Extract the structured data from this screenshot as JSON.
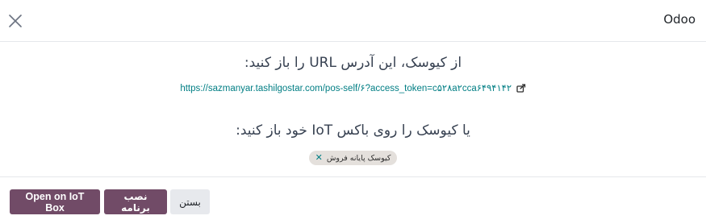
{
  "header": {
    "title": "Odoo"
  },
  "body": {
    "kiosk_url_heading": "از کیوسک، این آدرس URL را باز کنید:",
    "kiosk_url": "https://sazmanyar.tashilgostar.com/pos-self/۶?access_token=c۵۲۸a۲cca۶۴۹۴۱۴۲",
    "iot_heading": "یا کیوسک را روی باکس IoT خود باز کنید:",
    "iot_tag": "کیوسک پایانه فروش"
  },
  "footer": {
    "open_iot_label": "Open on IoT Box",
    "install_app_label": "نصب برنامه",
    "close_label": "بستن"
  },
  "colors": {
    "primary": "#714b67",
    "link": "#017e84",
    "tag_bg": "#e4e0dc"
  }
}
